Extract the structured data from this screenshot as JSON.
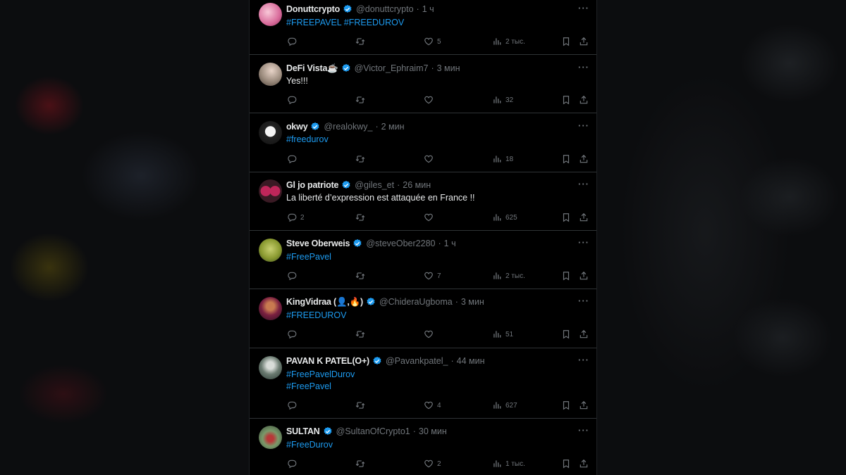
{
  "tweets": [
    {
      "name": "Donuttcrypto",
      "handle": "@donuttcrypto",
      "sep": "·",
      "time": "1 ч",
      "lines": [
        "#FREEPAVEL #FREEDUROV"
      ],
      "replies": "",
      "retweets": "",
      "likes": "5",
      "views": "2 тыс."
    },
    {
      "name": "DeFi Vista☕",
      "handle": "@Victor_Ephraim7",
      "sep": "·",
      "time": "3 мин",
      "lines": [
        "Yes!!!"
      ],
      "replies": "",
      "retweets": "",
      "likes": "",
      "views": "32"
    },
    {
      "name": "okwy",
      "handle": "@realokwy_",
      "sep": "·",
      "time": "2 мин",
      "lines": [
        "#freedurov"
      ],
      "replies": "",
      "retweets": "",
      "likes": "",
      "views": "18"
    },
    {
      "name": "Gl jo patriote",
      "handle": "@giles_et",
      "sep": "·",
      "time": "26 мин",
      "lines": [
        "La liberté d’expression est attaquée en France !!"
      ],
      "replies": "2",
      "retweets": "",
      "likes": "",
      "views": "625"
    },
    {
      "name": "Steve Oberweis",
      "handle": "@steveOber2280",
      "sep": "·",
      "time": "1 ч",
      "lines": [
        "#FreePavel"
      ],
      "replies": "",
      "retweets": "",
      "likes": "7",
      "views": "2 тыс."
    },
    {
      "name": "KingVidraa (👤,🔥)",
      "handle": "@ChideraUgboma",
      "sep": "·",
      "time": "3 мин",
      "lines": [
        "#FREEDUROV"
      ],
      "replies": "",
      "retweets": "",
      "likes": "",
      "views": "51"
    },
    {
      "name": "PAVAN K PATEL(O+)",
      "handle": "@Pavankpatel_",
      "sep": "·",
      "time": "44 мин",
      "lines": [
        "#FreePavelDurov",
        "#FreePavel"
      ],
      "replies": "",
      "retweets": "",
      "likes": "4",
      "views": "627"
    },
    {
      "name": "SULTAN",
      "handle": "@SultanOfCrypto1",
      "sep": "·",
      "time": "30 мин",
      "lines": [
        "#FreeDurov"
      ],
      "replies": "",
      "retweets": "",
      "likes": "2",
      "views": "1 тыс."
    }
  ],
  "more_label": "···",
  "colors": {
    "link": "#1d9bf0",
    "text": "#e7e9ea",
    "muted": "#71767b",
    "verified": "#1d9bf0"
  }
}
